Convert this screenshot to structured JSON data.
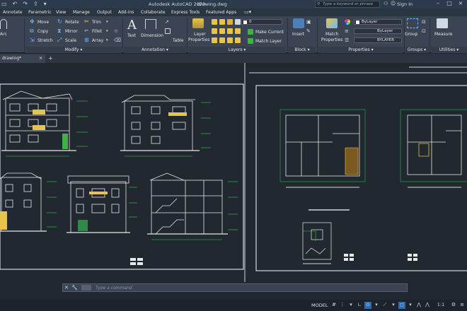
{
  "titlebar": {
    "app_title": "Autodesk AutoCAD 2020",
    "file_title": "drawing.dwg",
    "search_placeholder": "Type a keyword or phrase",
    "signin_label": "Sign In"
  },
  "menu_tabs": [
    "Annotate",
    "Parametric",
    "View",
    "Manage",
    "Output",
    "Add-ins",
    "Collaborate",
    "Express Tools",
    "Featured Apps"
  ],
  "ribbon": {
    "arc_label": "Arc",
    "modify": {
      "move": "Move",
      "rotate": "Rotate",
      "trim": "Trim",
      "copy": "Copy",
      "mirror": "Mirror",
      "fillet": "Fillet",
      "stretch": "Stretch",
      "scale": "Scale",
      "array": "Array",
      "panel_label": "Modify"
    },
    "annotation": {
      "text": "Text",
      "dimension": "Dimension",
      "table": "Table",
      "panel_label": "Annotation"
    },
    "layers": {
      "layer_properties": "Layer Properties",
      "layer_value": "0",
      "make_current": "Make Current",
      "match_layer": "Match Layer",
      "panel_label": "Layers"
    },
    "block": {
      "insert": "Insert",
      "panel_label": "Block"
    },
    "properties": {
      "match_properties": "Match Properties",
      "color_value": "ByLayer",
      "linetype_value": "ByLayer",
      "lineweight_value": "BYLAYER",
      "panel_label": "Properties"
    },
    "groups": {
      "group": "Group",
      "panel_label": "Groups"
    },
    "utilities": {
      "measure": "Measure",
      "panel_label": "Utilities"
    }
  },
  "doc_tab": {
    "name": "drawing*"
  },
  "command_line": {
    "placeholder": "Type a command"
  },
  "status": {
    "model": "MODEL",
    "scale": "1:1"
  },
  "colors": {
    "accent_yellow": "#e8c44a",
    "drawing_green": "#2bd24a",
    "drawing_white": "#e8e8e8",
    "background": "#212830"
  }
}
